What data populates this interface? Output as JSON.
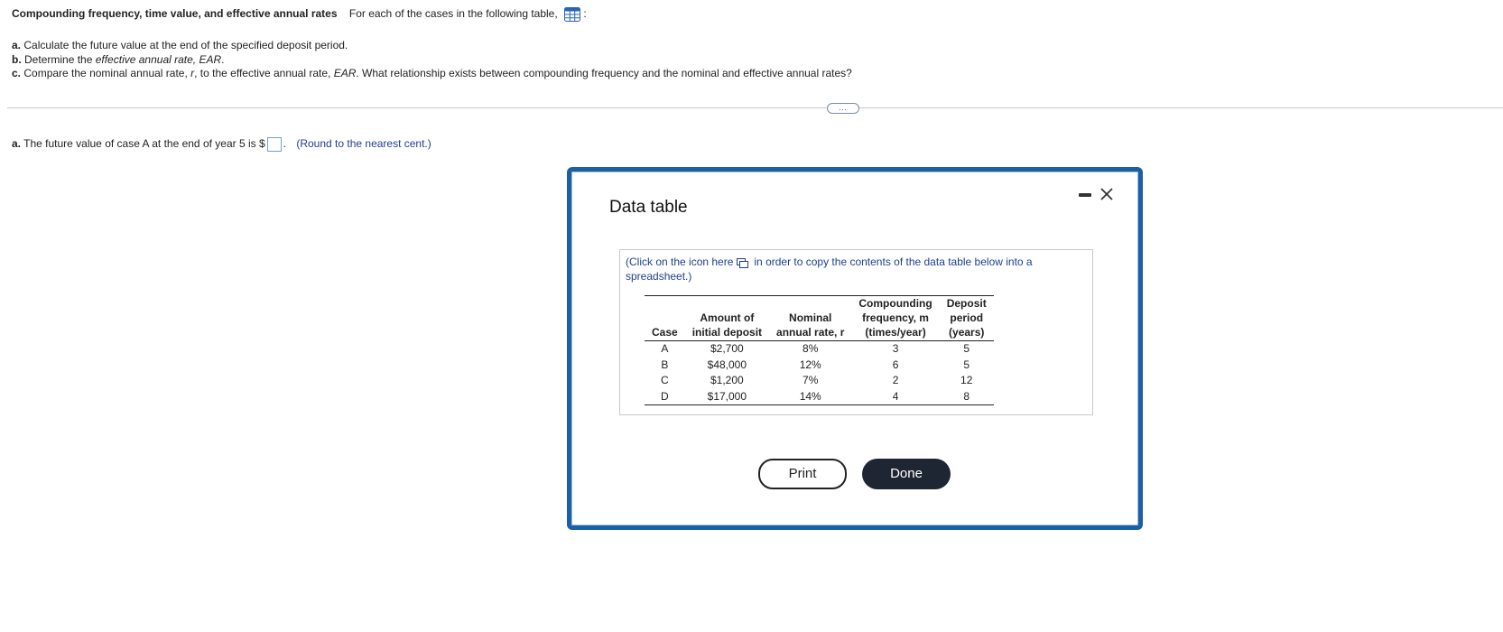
{
  "question": {
    "title_bold": "Compounding frequency, time value, and effective annual rates",
    "title_rest": "For each of the cases in the following table,",
    "title_colon": ":",
    "parts": [
      {
        "letter": "a.",
        "text": "Calculate the future value at the end of the specified deposit period."
      },
      {
        "letter": "b.",
        "text_pre": "Determine the ",
        "text_italic": "effective annual rate, EAR",
        "text_post": "."
      },
      {
        "letter": "c.",
        "text_pre": "Compare the nominal annual rate, ",
        "text_italic": "r",
        "text_mid": ", to the effective annual rate, ",
        "text_italic2": "EAR",
        "text_post": ". What relationship exists between compounding frequency and the nominal and effective annual rates?"
      }
    ],
    "ellipsis": "…",
    "answer": {
      "letter": "a.",
      "text": "The future value of case A at the end of year 5 is $",
      "after_box": ".",
      "note": "(Round to the nearest cent.)"
    }
  },
  "modal": {
    "title": "Data table",
    "copy_note_pre": "(Click on the icon here",
    "copy_note_post": "in order to copy the contents of the data table below into a spreadsheet.)",
    "table": {
      "headers": [
        [
          "Case"
        ],
        [
          "Amount of",
          "initial deposit"
        ],
        [
          "Nominal",
          "annual rate, r"
        ],
        [
          "Compounding",
          "frequency, m",
          "(times/year)"
        ],
        [
          "Deposit",
          "period",
          "(years)"
        ]
      ],
      "rows": [
        [
          "A",
          "$2,700",
          "8%",
          "3",
          "5"
        ],
        [
          "B",
          "$48,000",
          "12%",
          "6",
          "5"
        ],
        [
          "C",
          "$1,200",
          "7%",
          "2",
          "12"
        ],
        [
          "D",
          "$17,000",
          "14%",
          "4",
          "8"
        ]
      ]
    },
    "print_label": "Print",
    "done_label": "Done"
  },
  "colors": {
    "modal_border": "#1c5fa4",
    "link_text": "#1f3f8f",
    "done_bg": "#1e2633"
  }
}
